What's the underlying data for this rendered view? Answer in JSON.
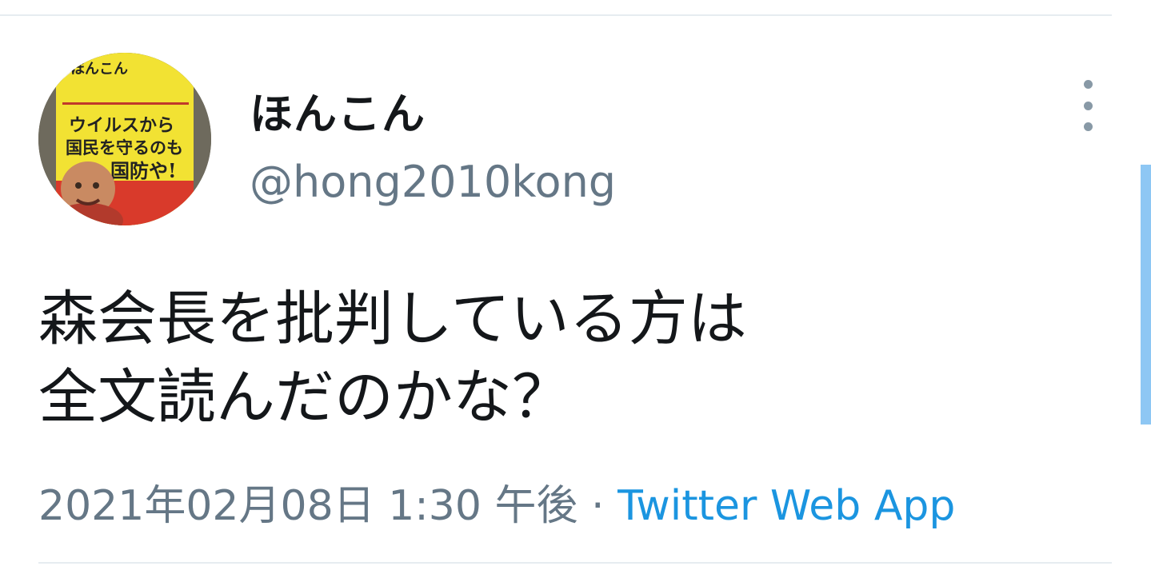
{
  "tweet": {
    "author": {
      "display_name": "ほんこん",
      "handle": "@hong2010kong",
      "avatar": {
        "description_icon": "avatar-book-cover",
        "cover_title": "ほんこん",
        "cover_lines": [
          "ウイルスから",
          "国民を守るのも",
          "国防や!"
        ]
      }
    },
    "text_lines": [
      "森会長を批判している方は",
      "全文読んだのかな？"
    ],
    "timestamp": "2021年02月08日 1:30 午後",
    "separator": " · ",
    "source": "Twitter Web App",
    "more_icon": "vertical-ellipsis-icon"
  },
  "colors": {
    "primary_text": "#14171a",
    "secondary_text": "#657786",
    "link": "#1b95e0",
    "divider": "#e6ecf0",
    "scrollbar": "#8ec7f4"
  }
}
